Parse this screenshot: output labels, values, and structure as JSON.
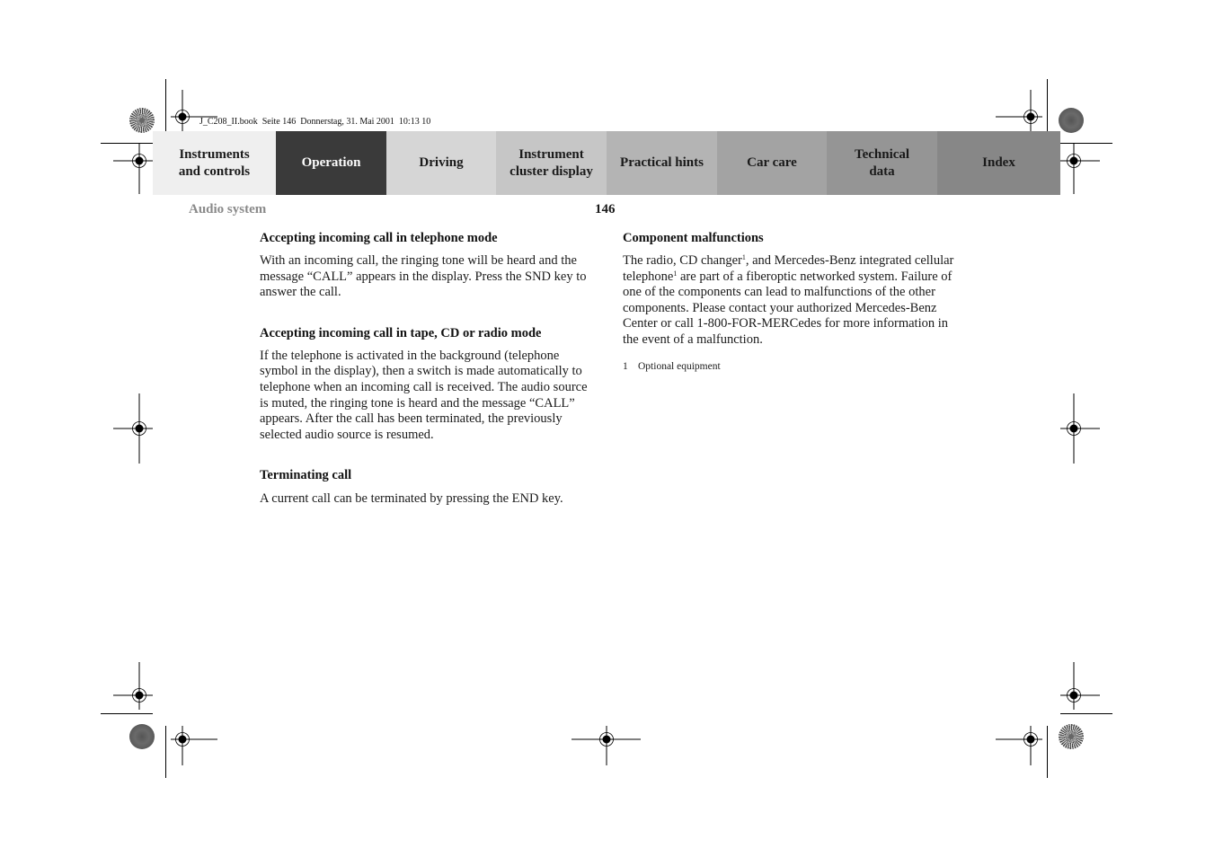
{
  "slug_text": "J_C208_II.book  Seite 146  Donnerstag, 31. Mai 2001  10:13 10",
  "tabs": [
    {
      "label": "Instruments\nand controls",
      "color": "#efefef",
      "active": false
    },
    {
      "label": "Operation",
      "color": "#3a3a3a",
      "active": true
    },
    {
      "label": "Driving",
      "color": "#d6d6d6",
      "active": false
    },
    {
      "label": "Instrument\ncluster display",
      "color": "#c6c6c6",
      "active": false
    },
    {
      "label": "Practical hints",
      "color": "#b4b4b4",
      "active": false
    },
    {
      "label": "Car care",
      "color": "#a3a3a3",
      "active": false
    },
    {
      "label": "Technical\ndata",
      "color": "#959595",
      "active": false
    },
    {
      "label": "Index",
      "color": "#878787",
      "active": false
    }
  ],
  "header": {
    "section_title": "Audio system",
    "page_number": "146"
  },
  "left_column": {
    "sections": [
      {
        "heading": "Accepting incoming call in telephone mode",
        "body": "With an incoming call, the ringing tone will be heard and the message “CALL” appears in the display. Press the SND key to answer the call."
      },
      {
        "heading": "Accepting incoming call in tape, CD or radio mode",
        "body": "If the telephone is activated in the background (telephone symbol in the display), then a switch is made automatically to telephone when an incoming call is received. The audio source is muted, the ringing tone is heard and the message “CALL” appears. After the call has been terminated, the previously selected audio source is resumed."
      },
      {
        "heading": "Terminating call",
        "body": "A current call can be terminated by pressing the END key."
      }
    ]
  },
  "right_column": {
    "heading": "Component malfunctions",
    "body_parts": [
      "The radio, CD changer",
      "1",
      ", and Mercedes-Benz integrated cellular telephone",
      "1",
      " are part of a fiberoptic networked system. Failure of one of the components can lead to malfunctions of the other components. Please contact your authorized Mercedes-Benz Center or call 1-800-FOR-MERCedes for more information in the event of a malfunction."
    ],
    "footnote": {
      "number": "1",
      "text": "Optional equipment"
    }
  }
}
